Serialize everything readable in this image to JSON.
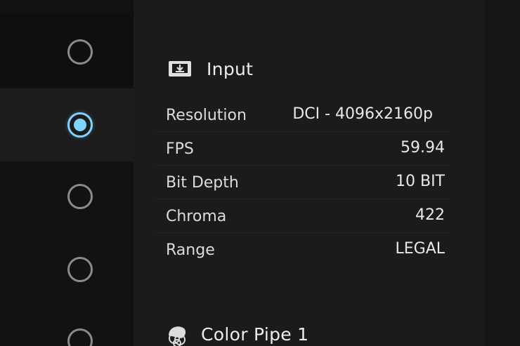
{
  "sidebar": {
    "radios": [
      {
        "name": "radio-option-1",
        "selected": false
      },
      {
        "name": "radio-option-2",
        "selected": true
      },
      {
        "name": "radio-option-3",
        "selected": false
      },
      {
        "name": "radio-option-4",
        "selected": false
      },
      {
        "name": "radio-option-5",
        "selected": false
      }
    ],
    "accent_color": "#7fd3ff"
  },
  "input_section": {
    "icon": "input-icon",
    "title": "Input",
    "rows": [
      {
        "label": "Resolution",
        "value": "DCI - 4096x2160p"
      },
      {
        "label": "FPS",
        "value": "59.94"
      },
      {
        "label": "Bit Depth",
        "value": "10 BIT"
      },
      {
        "label": "Chroma",
        "value": "422"
      },
      {
        "label": "Range",
        "value": "LEGAL"
      }
    ]
  },
  "color_pipe_section": {
    "icon": "color-pipe-icon",
    "title": "Color Pipe 1"
  }
}
